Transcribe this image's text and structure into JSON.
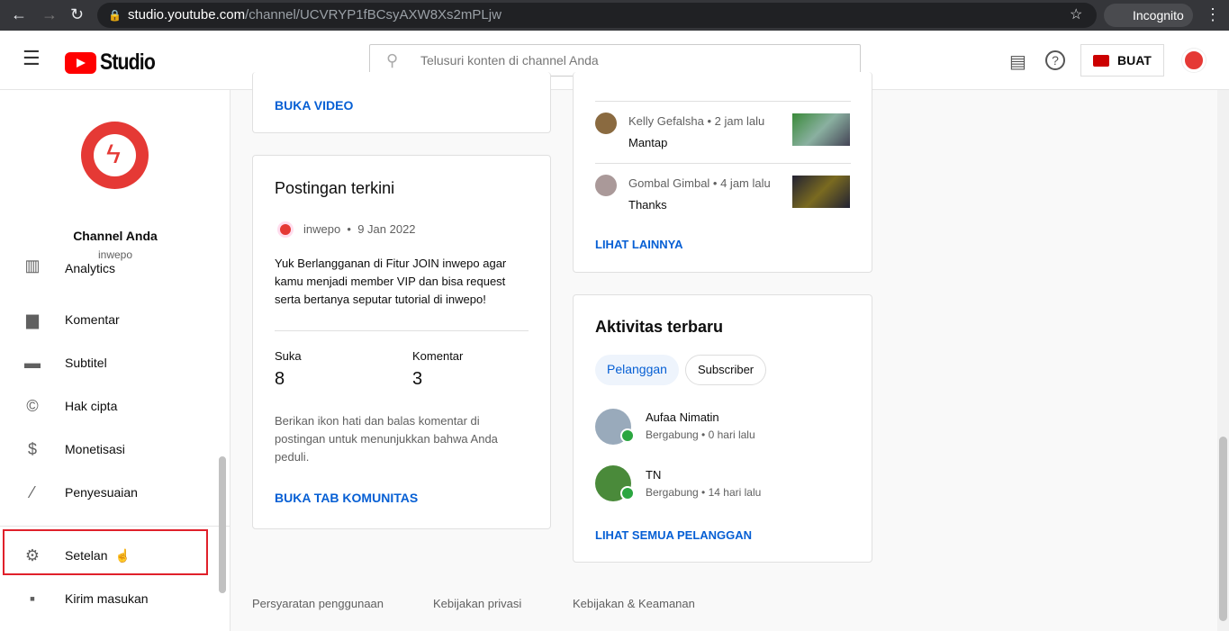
{
  "browser": {
    "url_host": "studio.youtube.com",
    "url_path": "/channel/UCVRYP1fBCsyAXW8Xs2mPLjw",
    "incognito": "Incognito"
  },
  "header": {
    "logo": "Studio",
    "search_placeholder": "Telusuri konten di channel Anda",
    "create": "BUAT"
  },
  "sidebar": {
    "channel_title": "Channel Anda",
    "channel_name": "inwepo",
    "items": [
      {
        "label": "Analytics"
      },
      {
        "label": "Komentar"
      },
      {
        "label": "Subtitel"
      },
      {
        "label": "Hak cipta"
      },
      {
        "label": "Monetisasi"
      },
      {
        "label": "Penyesuaian"
      },
      {
        "label": "Setelan"
      },
      {
        "label": "Kirim masukan"
      }
    ]
  },
  "video_card": {
    "link": "BUKA VIDEO"
  },
  "post_card": {
    "title": "Postingan terkini",
    "author": "inwepo",
    "date": "9 Jan 2022",
    "body": "Yuk Berlangganan di Fitur JOIN inwepo agar kamu menjadi member VIP dan bisa request serta bertanya seputar tutorial di inwepo!",
    "likes_label": "Suka",
    "likes": "8",
    "comments_label": "Komentar",
    "comments": "3",
    "hint": "Berikan ikon hati dan balas komentar di postingan untuk menunjukkan bahwa Anda peduli.",
    "link": "BUKA TAB KOMUNITAS"
  },
  "comments_card": {
    "comments": [
      {
        "author": "Kelly Gefalsha",
        "time": "2 jam lalu",
        "text": "Mantap"
      },
      {
        "author": "Gombal Gimbal",
        "time": "4 jam lalu",
        "text": "Thanks"
      }
    ],
    "link": "LIHAT LAINNYA"
  },
  "activity_card": {
    "title": "Aktivitas terbaru",
    "chips": [
      "Pelanggan",
      "Subscriber"
    ],
    "subs": [
      {
        "name": "Aufaa Nimatin",
        "meta": "Bergabung • 0 hari lalu"
      },
      {
        "name": "TN",
        "meta": "Bergabung • 14 hari lalu"
      }
    ],
    "link": "LIHAT SEMUA PELANGGAN"
  },
  "footer": [
    "Persyaratan penggunaan",
    "Kebijakan privasi",
    "Kebijakan & Keamanan"
  ],
  "colors": {
    "accent": "#065fd4",
    "brand": "#ff0000",
    "highlight": "#e53935"
  }
}
